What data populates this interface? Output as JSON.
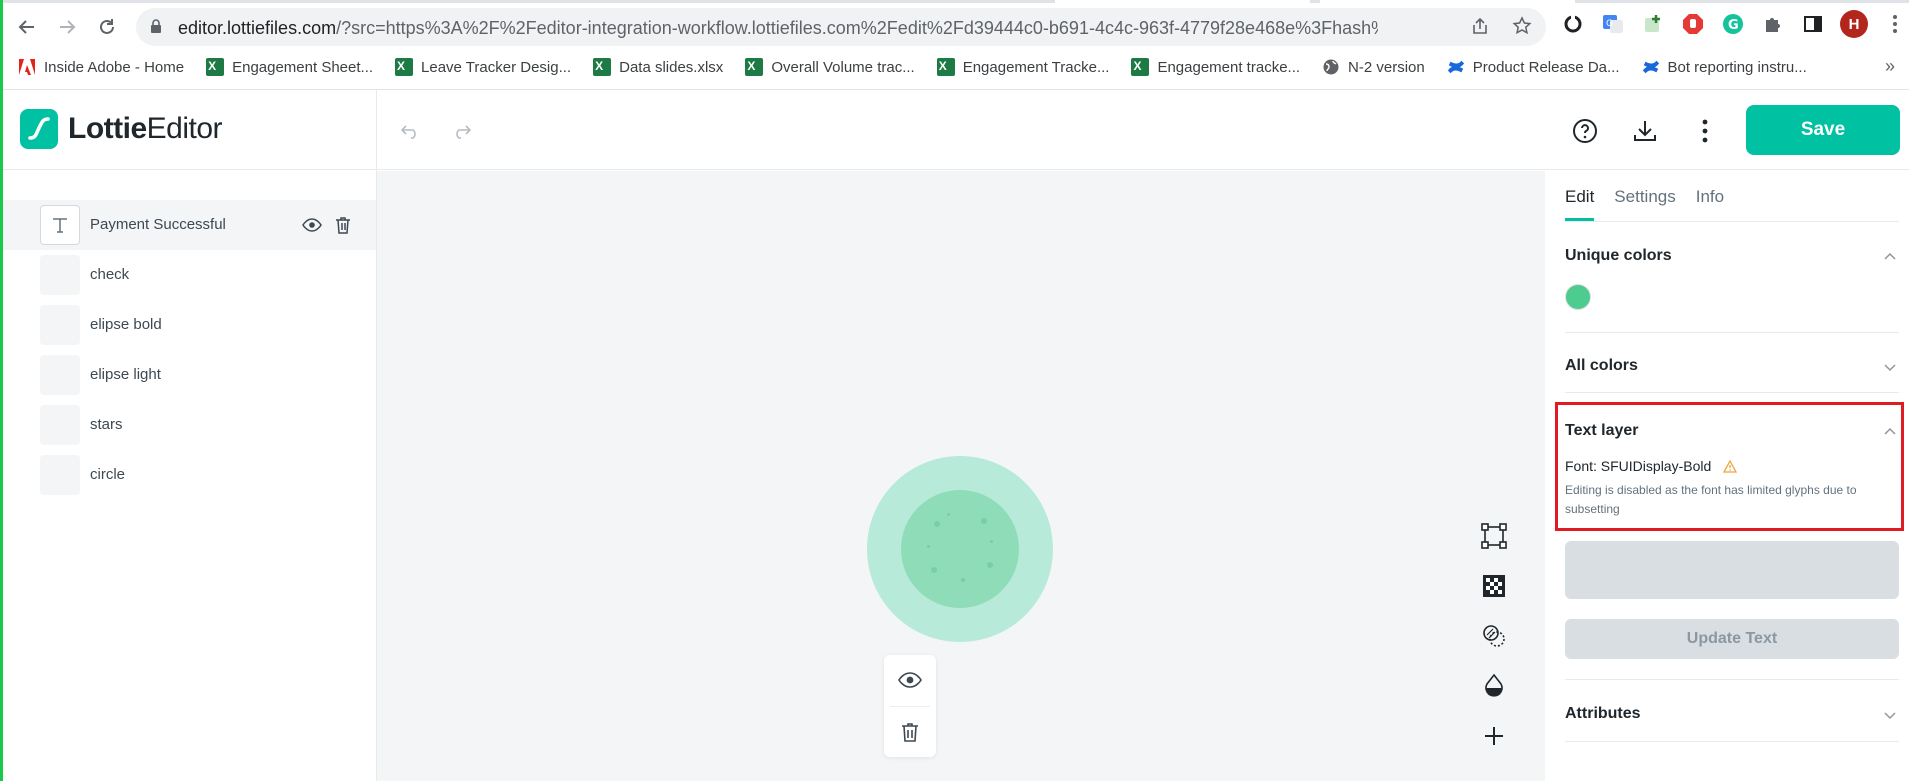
{
  "browser": {
    "url_host": "editor.lottiefiles.com",
    "url_rest": "/?src=https%3A%2F%2Feditor-integration-workflow.lottiefiles.com%2Fedit%2Fd39444c0-b691-4c4c-963f-4779f28e468e%3Fhash%3DeyJhbGci...",
    "avatar_letter": "H",
    "bookmarks": [
      {
        "label": "Inside Adobe - Home",
        "icon": "adobe-icon"
      },
      {
        "label": "Engagement Sheet...",
        "icon": "excel-icon"
      },
      {
        "label": "Leave Tracker Desig...",
        "icon": "excel-icon"
      },
      {
        "label": "Data slides.xlsx",
        "icon": "excel-icon"
      },
      {
        "label": "Overall Volume trac...",
        "icon": "excel-icon"
      },
      {
        "label": "Engagement Tracke...",
        "icon": "excel-icon"
      },
      {
        "label": "Engagement tracke...",
        "icon": "excel-icon"
      },
      {
        "label": "N-2 version",
        "icon": "globe-icon"
      },
      {
        "label": "Product Release Da...",
        "icon": "confluence-icon"
      },
      {
        "label": "Bot reporting instru...",
        "icon": "confluence-icon"
      }
    ],
    "bookmarks_more": "»"
  },
  "app": {
    "logo_bold": "Lottie",
    "logo_regular": "Editor",
    "save_label": "Save",
    "accent": "#00c1a2"
  },
  "layers": [
    {
      "name": "Payment Successful",
      "selected": true,
      "thumb": "text-icon"
    },
    {
      "name": "check"
    },
    {
      "name": "elipse bold"
    },
    {
      "name": "elipse light"
    },
    {
      "name": "stars"
    },
    {
      "name": "circle"
    }
  ],
  "panel": {
    "tabs": [
      "Edit",
      "Settings",
      "Info"
    ],
    "active_tab": "Edit",
    "unique_colors_title": "Unique colors",
    "unique_color_swatch": "#4ecb8f",
    "all_colors_title": "All colors",
    "text_layer_title": "Text layer",
    "font_label": "Font: SFUIDisplay-Bold",
    "font_note": "Editing is disabled as the font has limited glyphs due to subsetting",
    "update_text_label": "Update Text",
    "attributes_title": "Attributes"
  }
}
